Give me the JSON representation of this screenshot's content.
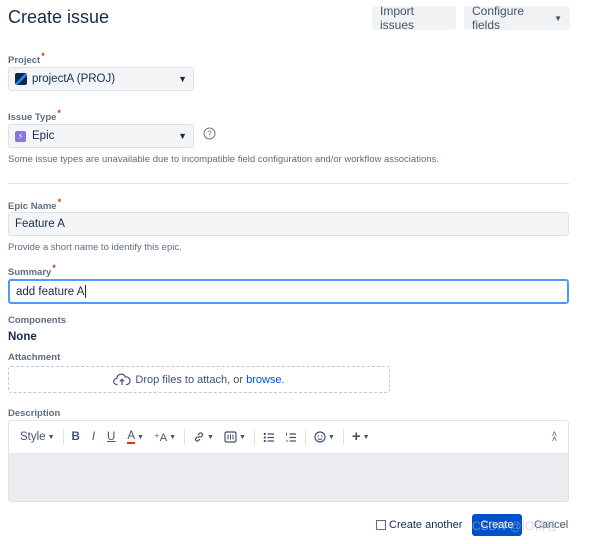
{
  "header": {
    "title": "Create issue",
    "import_label": "Import issues",
    "configure_label": "Configure fields"
  },
  "project": {
    "label": "Project",
    "required_mark": "*",
    "value": "projectA (PROJ)"
  },
  "issue_type": {
    "label": "Issue Type",
    "required_mark": "*",
    "value": "Epic",
    "help_text": "Some issue types are unavailable due to incompatible field configuration and/or workflow associations."
  },
  "epic_name": {
    "label": "Epic Name",
    "required_mark": "*",
    "value": "Feature A",
    "help_text": "Provide a short name to identify this epic."
  },
  "summary": {
    "label": "Summary",
    "required_mark": "*",
    "value": "add feature A"
  },
  "components": {
    "label": "Components",
    "value": "None"
  },
  "attachment": {
    "label": "Attachment",
    "drop_text": "Drop files to attach, or ",
    "browse_link": "browse."
  },
  "description": {
    "label": "Description",
    "style_label": "Style",
    "bold": "B",
    "italic": "I",
    "underline": "U",
    "text_color": "A"
  },
  "footer": {
    "create_another_label": "Create another",
    "create_label": "Create",
    "cancel_label": "Cancel",
    "watermark": "CSDN @IO博客"
  },
  "colors": {
    "primary": "#0052cc",
    "focus_border": "#4c9aff",
    "required": "#de350b",
    "epic": "#8777d9"
  }
}
